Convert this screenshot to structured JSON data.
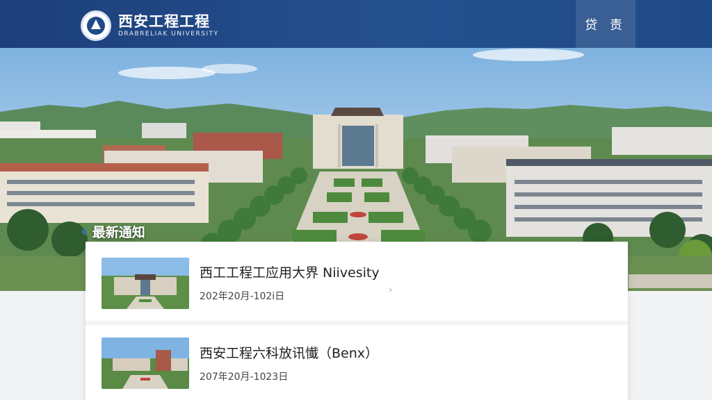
{
  "header": {
    "logo_cn": "西安工程工程",
    "logo_en": "DRABRELIAK UNIVERSITY",
    "nav_button": "贷 责"
  },
  "hero": {
    "image": "campus aerial view with main building, tree-lined plaza and mountains"
  },
  "section": {
    "title": "最新通知"
  },
  "news": [
    {
      "title": "西工工程工应用大界 Niivesity",
      "date": "202年20月-102i日",
      "thumbnail": "campus-building-thumbnail"
    },
    {
      "title": "西安工程六科放讯懴（Benx）",
      "date": "207年20月-1023日",
      "thumbnail": "campus-building-thumbnail"
    }
  ],
  "colors": {
    "header_bg": "#24508f",
    "header_button_bg": "#3a5f95",
    "accent": "#2f78d0"
  }
}
